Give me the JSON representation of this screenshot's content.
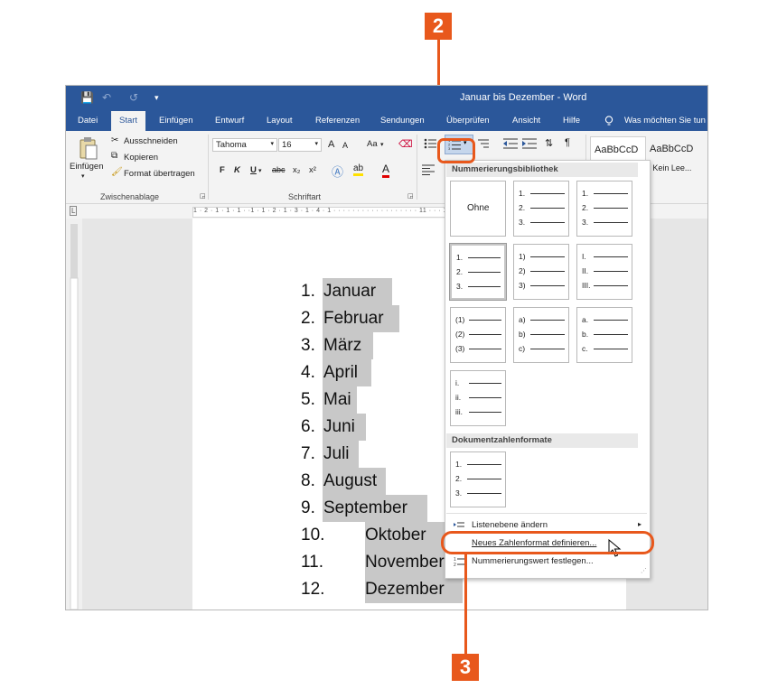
{
  "window": {
    "title": "Januar bis Dezember  -  Word",
    "qat": {
      "save": "💾",
      "undo": "↶",
      "redo": "↺",
      "customize": "▾"
    }
  },
  "tabs": [
    "Datei",
    "Start",
    "Einfügen",
    "Entwurf",
    "Layout",
    "Referenzen",
    "Sendungen",
    "Überprüfen",
    "Ansicht",
    "Hilfe"
  ],
  "tell_me": "Was möchten Sie tun",
  "clipboard": {
    "paste": "Einfügen",
    "cut": "Ausschneiden",
    "copy": "Kopieren",
    "format_painter": "Format übertragen",
    "group": "Zwischenablage"
  },
  "font": {
    "name": "Tahoma",
    "size": "16",
    "grow": "A",
    "shrink": "A",
    "case": "Aa",
    "bold": "F",
    "italic": "K",
    "underline": "U",
    "strike": "abc",
    "sub": "x₂",
    "sup": "x²",
    "group": "Schriftart"
  },
  "styles": {
    "normal": "AaBbCcD",
    "no_spacing": "AaBbCcD",
    "no_spacing_label": "¶ Kein Lee..."
  },
  "ruler": "1 · 2 · 1 · 1 · 1 · ·1 · 1 · 2 · 1 · 3 · 1 · 4 · 1 · · · · · · · · · · · · · · · · · · 11 · · · 12 ·",
  "list": [
    {
      "num": "1.",
      "text": "Januar"
    },
    {
      "num": "2.",
      "text": "Februar"
    },
    {
      "num": "3.",
      "text": "März"
    },
    {
      "num": "4.",
      "text": "April"
    },
    {
      "num": "5.",
      "text": "Mai"
    },
    {
      "num": "6.",
      "text": "Juni"
    },
    {
      "num": "7.",
      "text": "Juli"
    },
    {
      "num": "8.",
      "text": "August"
    },
    {
      "num": "9.",
      "text": "September"
    },
    {
      "num": "10.",
      "text": "Oktober"
    },
    {
      "num": "11.",
      "text": "November"
    },
    {
      "num": "12.",
      "text": "Dezember"
    }
  ],
  "menu": {
    "library_header": "Nummerierungsbibliothek",
    "none_label": "Ohne",
    "formats": [
      [
        "1.",
        "2.",
        "3."
      ],
      [
        "1.",
        "2.",
        "3."
      ],
      [
        "1.",
        "2.",
        "3."
      ],
      [
        "1)",
        "2)",
        "3)"
      ],
      [
        "I.",
        "II.",
        "III."
      ],
      [
        "(1)",
        "(2)",
        "(3)"
      ],
      [
        "a)",
        "b)",
        "c)"
      ],
      [
        "a.",
        "b.",
        "c."
      ],
      [
        "i.",
        "ii.",
        "iii."
      ]
    ],
    "doc_header": "Dokumentzahlenformate",
    "doc_format": [
      "1.",
      "2.",
      "3."
    ],
    "change_level": "Listenebene ändern",
    "define_new": "Neues Zahlenformat definieren...",
    "set_value": "Nummerierungswert festlegen..."
  },
  "callouts": {
    "step2": "2",
    "step3": "3"
  },
  "colors": {
    "word_blue": "#2b579a",
    "callout_orange": "#e8581c",
    "highlight": "#c8c8c8"
  }
}
